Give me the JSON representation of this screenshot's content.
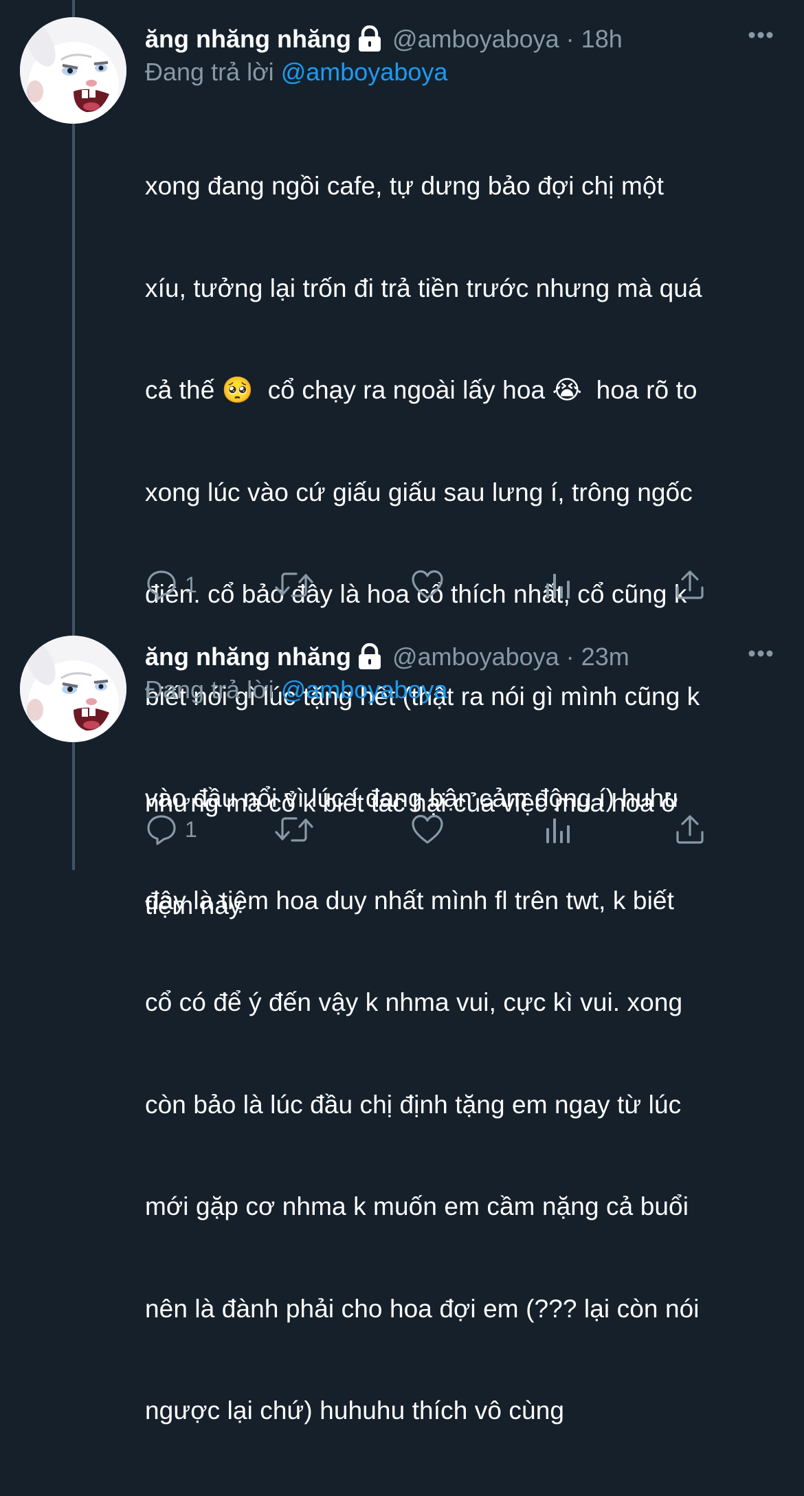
{
  "colors": {
    "background": "#15202b",
    "secondary_text": "#8899a6",
    "mention": "#1d9bf0",
    "thread_line": "#3d5466"
  },
  "tweets": [
    {
      "display_name": "ăng nhăng nhăng",
      "handle": "@amboyaboya",
      "separator": "·",
      "time": "18h",
      "reply_prefix": "Đang trả lời",
      "reply_mention": "@amboyaboya",
      "body_lines": [
        "xong đang ngồi cafe, tự dưng bảo đợi chị một",
        "xíu, tưởng lại trốn đi trả tiền trước nhưng mà quá",
        "cả thế 🥺  cổ chạy ra ngoài lấy hoa 😭  hoa rõ to",
        "xong lúc vào cứ giấu giấu sau lưng í, trông ngốc",
        "điên. cổ bảo đây là hoa cổ thích nhất, cổ cũng k",
        "biết nói gì lúc tặng hết (thật ra nói gì mình cũng k",
        "vào đầu nổi vì lúc í đang bận cảm động í) huhu",
        "đây là tiệm hoa duy nhất mình fl trên twt, k biết",
        "cổ có để ý đến vậy k nhma vui, cực kì vui. xong",
        "còn bảo là lúc đầu chị định tặng em ngay từ lúc",
        "mới gặp cơ nhma k muốn em cầm nặng cả buổi",
        "nên là đành phải cho hoa đợi em (??? lại còn nói",
        "ngược lại chứ) huhuhu thích vô cùng"
      ],
      "reply_count": "1",
      "icons": [
        "lock-icon",
        "more-icon",
        "reply-icon",
        "retweet-icon",
        "like-icon",
        "analytics-icon",
        "share-icon"
      ]
    },
    {
      "display_name": "ăng nhăng nhăng",
      "handle": "@amboyaboya",
      "separator": "·",
      "time": "23m",
      "reply_prefix": "Đang trả lời",
      "reply_mention": "@amboyaboya",
      "body_lines": [
        "nhưng mà cổ k biết tác hại của việc mua hoa ở",
        "tiệm này"
      ],
      "reply_count": "1",
      "icons": [
        "lock-icon",
        "more-icon",
        "reply-icon",
        "retweet-icon",
        "like-icon",
        "analytics-icon",
        "share-icon"
      ]
    }
  ]
}
